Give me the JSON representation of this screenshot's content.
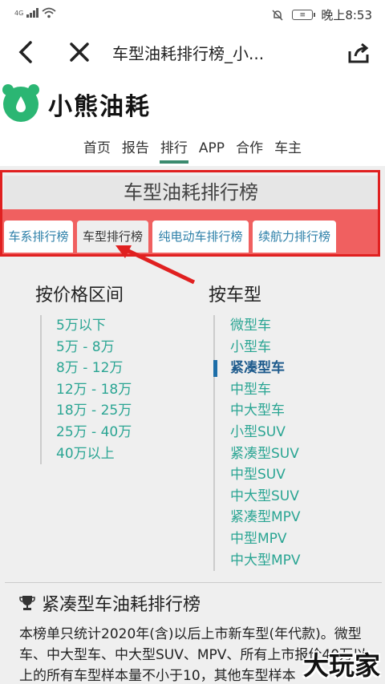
{
  "statusbar": {
    "network": "4G",
    "time": "晚上8:53",
    "battery_label": "≡"
  },
  "titlebar": {
    "title": "车型油耗排行榜_小..."
  },
  "logo": {
    "text": "小熊油耗",
    "brand_color": "#2bb673"
  },
  "nav": {
    "items": [
      {
        "label": "首页"
      },
      {
        "label": "报告"
      },
      {
        "label": "排行",
        "active": true
      },
      {
        "label": "APP"
      },
      {
        "label": "合作"
      },
      {
        "label": "车主"
      }
    ]
  },
  "rank": {
    "title": "车型油耗排行榜",
    "tabs": [
      {
        "label": "车系排行榜"
      },
      {
        "label": "车型排行榜",
        "active": true
      },
      {
        "label": "纯电动车排行榜"
      },
      {
        "label": "续航力排行榜"
      }
    ]
  },
  "price": {
    "heading": "按价格区间",
    "items": [
      "5万以下",
      "5万 - 8万",
      "8万 - 12万",
      "12万 - 18万",
      "18万 - 25万",
      "25万 - 40万",
      "40万以上"
    ]
  },
  "cartype": {
    "heading": "按车型",
    "items": [
      "微型车",
      "小型车",
      "紧凑型车",
      "中型车",
      "中大型车",
      "小型SUV",
      "紧凑型SUV",
      "中型SUV",
      "中大型SUV",
      "紧凑型MPV",
      "中型MPV",
      "中大型MPV"
    ],
    "active_index": 2
  },
  "section": {
    "title": "紧凑型车油耗排行榜",
    "desc": "本榜单只统计2020年(含)以后上市新车型(年代款)。微型车、中大型车、中大型SUV、MPV、所有上市报价40万以上的所有车型样本量不小于10，其他车型样本"
  },
  "watermark": "大玩家",
  "colors": {
    "accent": "#2aa593",
    "tab_band": "#f06060",
    "highlight_box": "#e02020"
  }
}
